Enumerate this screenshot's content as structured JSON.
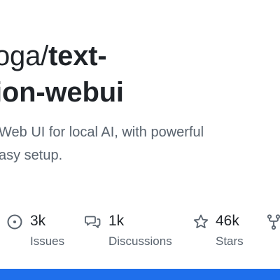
{
  "repo": {
    "owner": "oga",
    "separator": "/",
    "name_line1": "text-",
    "name_line2": "ion-webui"
  },
  "description": {
    "line1": "Web UI for local AI, with powerful",
    "line2": "asy setup."
  },
  "stats": [
    {
      "icon": "issue-circle-icon",
      "count": "3k",
      "label": "Issues"
    },
    {
      "icon": "discussion-bubbles-icon",
      "count": "1k",
      "label": "Discussions"
    },
    {
      "icon": "star-icon",
      "count": "46k",
      "label": "Stars"
    },
    {
      "icon": "fork-icon",
      "count": "",
      "label": ""
    }
  ],
  "colors": {
    "text": "#1f2328",
    "muted": "#59636e",
    "accent_bar": "#1f6feb"
  }
}
